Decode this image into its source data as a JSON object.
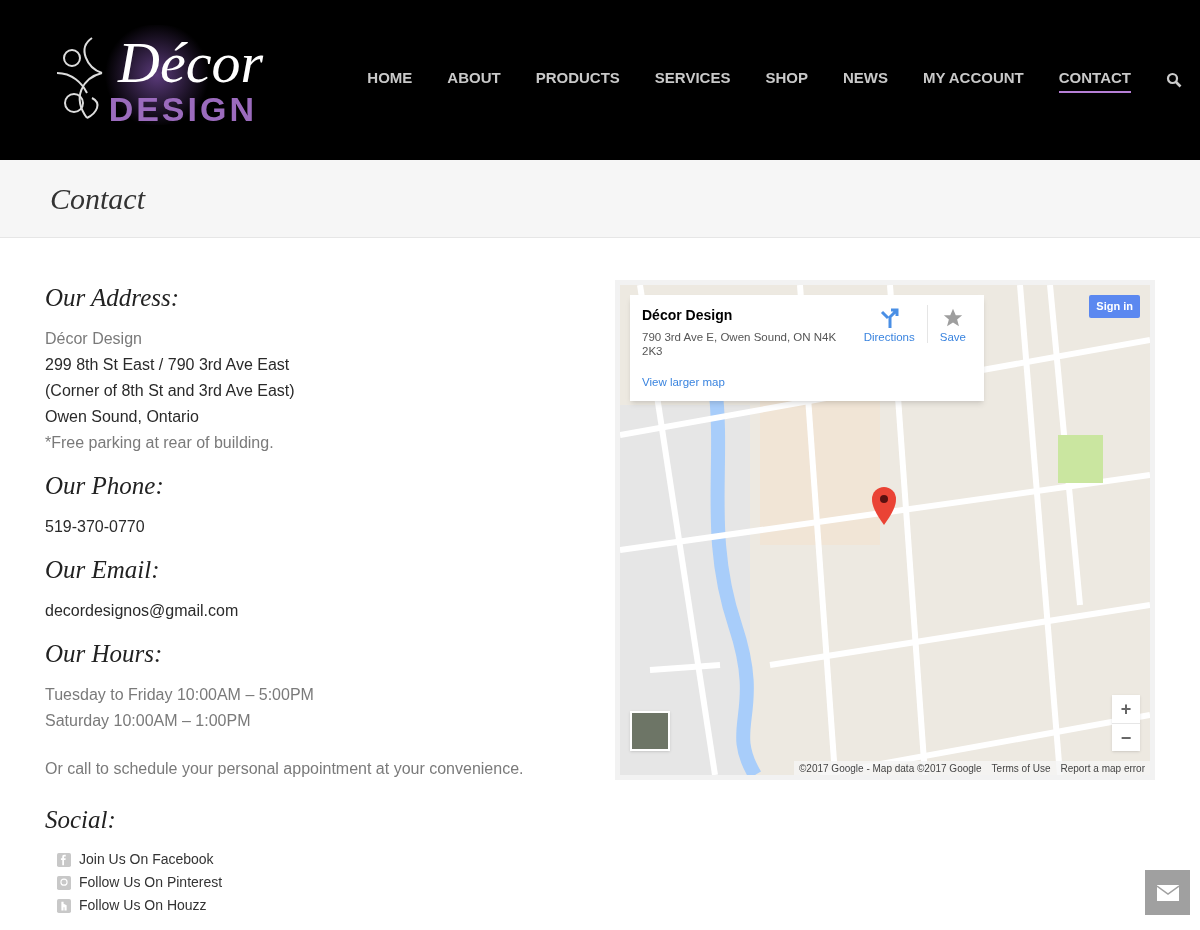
{
  "logo": {
    "script": "Décor",
    "word": "DESIGN"
  },
  "nav": [
    {
      "label": "HOME",
      "selected": false
    },
    {
      "label": "ABOUT",
      "selected": false
    },
    {
      "label": "PRODUCTS",
      "selected": false
    },
    {
      "label": "SERVICES",
      "selected": false
    },
    {
      "label": "SHOP",
      "selected": false
    },
    {
      "label": "NEWS",
      "selected": false
    },
    {
      "label": "MY ACCOUNT",
      "selected": false
    },
    {
      "label": "CONTACT",
      "selected": true
    }
  ],
  "page_title": "Contact",
  "sections": [
    {
      "heading": "Our Address:",
      "lines": [
        {
          "text": "Décor Design",
          "muted": true
        },
        {
          "text": "299 8th St East / 790 3rd Ave East",
          "muted": false
        },
        {
          "text": "(Corner of 8th St and 3rd Ave East)",
          "muted": false
        },
        {
          "text": "Owen Sound, Ontario",
          "muted": false
        },
        {
          "text": "*Free parking at rear of building.",
          "muted": true
        }
      ]
    },
    {
      "heading": "Our Phone:",
      "lines": [
        {
          "text": "519-370-0770",
          "muted": false
        }
      ]
    },
    {
      "heading": "Our Email:",
      "lines": [
        {
          "text": "decordesignos@gmail.com",
          "muted": false
        }
      ]
    },
    {
      "heading": "Our Hours:",
      "lines": [
        {
          "text": "Tuesday to Friday 10:00AM – 5:00PM",
          "muted": true
        },
        {
          "text": "Saturday 10:00AM – 1:00PM",
          "muted": true
        }
      ]
    }
  ],
  "note": "Or call to schedule your personal appointment at your convenience.",
  "social": {
    "heading": "Social:",
    "links": [
      {
        "kind": "facebook",
        "label": "Join Us On Facebook"
      },
      {
        "kind": "pinterest",
        "label": "Follow Us On Pinterest"
      },
      {
        "kind": "houzz",
        "label": "Follow Us On Houzz"
      }
    ]
  },
  "map": {
    "place": {
      "name": "Décor Design",
      "address": "790 3rd Ave E, Owen Sound, ON N4K 2K3",
      "directions": "Directions",
      "save": "Save",
      "larger": "View larger map"
    },
    "sign_in": "Sign in",
    "zoom_in": "+",
    "zoom_out": "−",
    "footer": [
      "©2017 Google - Map data ©2017 Google",
      "Terms of Use",
      "Report a map error"
    ]
  }
}
